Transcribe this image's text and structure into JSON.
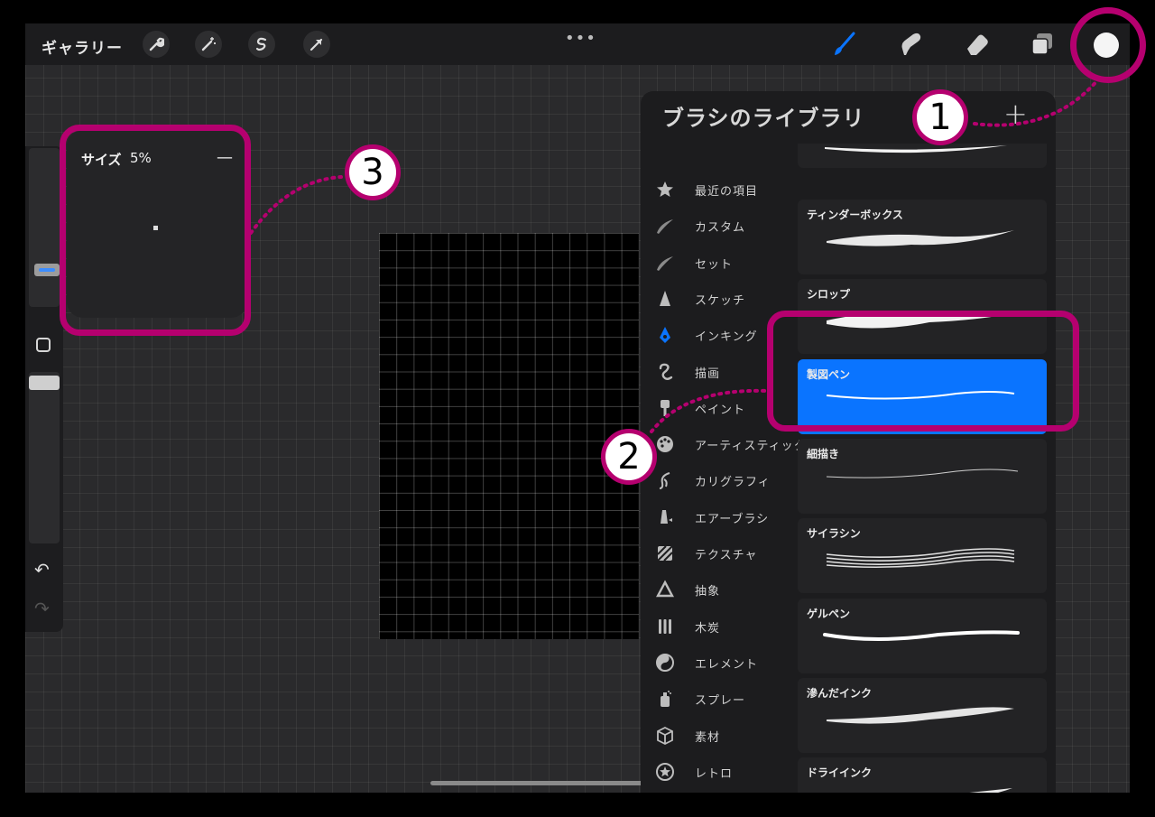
{
  "toolbar": {
    "gallery_label": "ギャラリー",
    "left_icons": [
      "wrench-icon",
      "magic-wand-icon",
      "selection-s-icon",
      "arrow-transform-icon"
    ],
    "more_label": "•••",
    "right_icons": [
      "brush-icon",
      "smudge-icon",
      "eraser-icon",
      "layers-icon",
      "color-dot"
    ],
    "active_tool": "brush",
    "active_color": "#0a74ff",
    "current_color": "#f5f5f5"
  },
  "size_popup": {
    "label": "サイズ",
    "value": "5%",
    "minus": "—"
  },
  "sidebar": {
    "undo_icon": "↶",
    "redo_icon": "↷"
  },
  "brush_library": {
    "title": "ブラシのライブラリ",
    "add_label": "+",
    "categories": [
      {
        "label": "最近の項目",
        "icon": "star-icon"
      },
      {
        "label": "カスタム",
        "icon": "brush-stroke-icon"
      },
      {
        "label": "セット",
        "icon": "brush-stroke-icon"
      },
      {
        "label": "スケッチ",
        "icon": "pencil-tip-icon"
      },
      {
        "label": "インキング",
        "icon": "pen-nib-icon"
      },
      {
        "label": "描画",
        "icon": "squiggle-icon"
      },
      {
        "label": "ペイント",
        "icon": "paint-brush-icon"
      },
      {
        "label": "アーティスティック",
        "icon": "palette-icon"
      },
      {
        "label": "カリグラフィ",
        "icon": "calligraphy-icon"
      },
      {
        "label": "エアーブラシ",
        "icon": "airbrush-icon"
      },
      {
        "label": "テクスチャ",
        "icon": "texture-icon"
      },
      {
        "label": "抽象",
        "icon": "triangle-icon"
      },
      {
        "label": "木炭",
        "icon": "charcoal-icon"
      },
      {
        "label": "エレメント",
        "icon": "yin-yang-icon"
      },
      {
        "label": "スプレー",
        "icon": "spray-can-icon"
      },
      {
        "label": "素材",
        "icon": "cube-icon"
      },
      {
        "label": "レトロ",
        "icon": "retro-star-icon"
      }
    ],
    "active_category": "インキング",
    "brushes": [
      {
        "name": ""
      },
      {
        "name": "ティンダーボックス"
      },
      {
        "name": "シロップ"
      },
      {
        "name": "製図ペン",
        "selected": true
      },
      {
        "name": "細描き"
      },
      {
        "name": "サイラシン"
      },
      {
        "name": "ゲルペン"
      },
      {
        "name": "滲んだインク"
      },
      {
        "name": "ドライインク"
      }
    ]
  },
  "annotations": {
    "color": "#b5006f",
    "markers": [
      {
        "label": "1"
      },
      {
        "label": "2"
      },
      {
        "label": "3"
      }
    ]
  }
}
